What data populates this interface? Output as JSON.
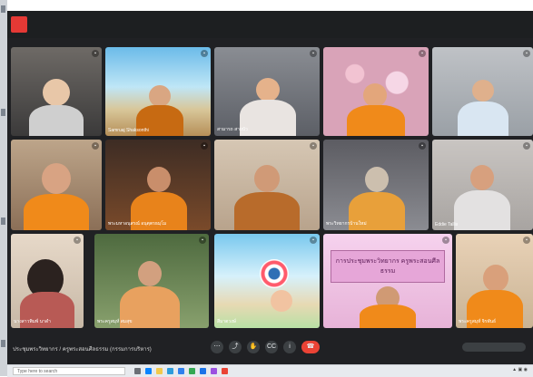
{
  "meeting": {
    "bottom_title": "ประชุมพระวิทยากร / ครูพระสอนศีลธรรม (กรรมการบริหาร)",
    "banner_text": "การประชุมพระวิทยากร ครูพระสอนศีลธรรม",
    "participants": [
      {
        "name": "",
        "tile": "t1"
      },
      {
        "name": "Samruaj Shaksonthi",
        "tile": "t2"
      },
      {
        "name": "สามารถ สายบัว",
        "tile": "t3"
      },
      {
        "name": "",
        "tile": "t4"
      },
      {
        "name": "",
        "tile": "t5"
      },
      {
        "name": "",
        "tile": "t6"
      },
      {
        "name": "พระมหาอนุสรณ์ อนุตฺตรธมฺโม",
        "tile": "t7"
      },
      {
        "name": "",
        "tile": "t8"
      },
      {
        "name": "พระวิทยากรบ้านใหม่",
        "tile": "t9"
      },
      {
        "name": "Eddie Tallia",
        "tile": "t10"
      },
      {
        "name": "นางสาวพิมพ์ นาดำ",
        "tile": "t11"
      },
      {
        "name": "พระครูสมุห์ สมสุข",
        "tile": "t12"
      },
      {
        "name": "สีมาตวงษ์",
        "tile": "t13"
      },
      {
        "name": "",
        "tile": "t14"
      },
      {
        "name": "พระครูสมุห์ จิรพันธ์",
        "tile": "t15"
      }
    ]
  },
  "controls": {
    "icons": [
      "more-icon",
      "present-icon",
      "hand-icon",
      "captions-icon",
      "info-icon"
    ],
    "end_call_icon": "end-call-icon"
  },
  "taskbar": {
    "search_placeholder": "Type here to search",
    "icons": [
      "task-view-icon",
      "edge-icon",
      "folder-icon",
      "store-icon",
      "mail-icon",
      "chrome-icon",
      "word-icon",
      "photos-icon",
      "app-icon"
    ]
  },
  "colors": {
    "accent": "#ea4335",
    "monk_robe": "#f08a1a"
  }
}
